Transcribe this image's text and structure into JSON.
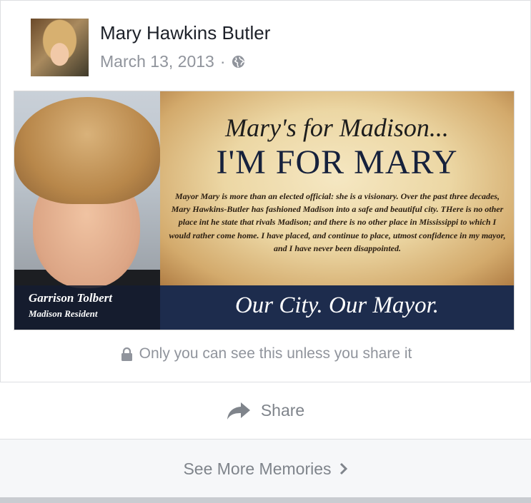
{
  "post": {
    "author": "Mary Hawkins Butler",
    "date": "March 13, 2013",
    "separator": "·",
    "audience_icon": "globe-icon"
  },
  "image": {
    "headline_line1": "Mary's for Madison...",
    "headline_line2": "I'M FOR MARY",
    "body_text": "Mayor Mary is more than an elected official: she is a visionary.  Over the past three decades, Mary Hawkins-Butler has fashioned Madison into a safe and beautiful city.  THere is no other place int he state that rivals Madison; and there is no other place in Mississippi to which I would rather come home.  I have placed, and continue to place, utmost confidence in my mayor, and I have never been disappointed.",
    "person_name": "Garrison Tolbert",
    "person_role": "Madison Resident",
    "slogan": "Our City. Our Mayor."
  },
  "privacy": {
    "icon": "lock-icon",
    "text": "Only you can see this unless you share it"
  },
  "actions": {
    "share_label": "Share",
    "share_icon": "share-arrow-icon",
    "see_more_label": "See More Memories",
    "see_more_icon": "chevron-right-icon"
  }
}
